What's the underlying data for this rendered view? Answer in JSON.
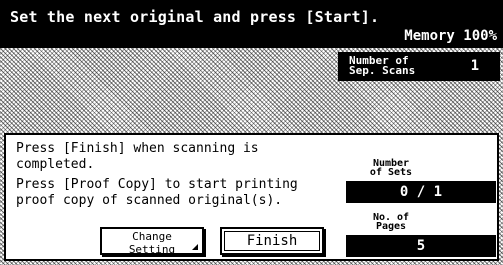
{
  "header": {
    "message": "Set the next original and press [Start].",
    "memory": "Memory 100%"
  },
  "sep_scans": {
    "label_line1": "Number of",
    "label_line2": "Sep. Scans",
    "value": "1"
  },
  "info": {
    "line1": "Press [Finish] when scanning is",
    "line2": "completed.",
    "line3": "Press [Proof Copy] to start printing",
    "line4": "proof copy of scanned original(s)."
  },
  "buttons": {
    "change_line1": "Change",
    "change_line2": "Setting",
    "finish": "Finish"
  },
  "counters": {
    "sets_label_line1": "Number",
    "sets_label_line2": "of Sets",
    "sets_value": "0 / 1",
    "pages_label_line1": "No. of",
    "pages_label_line2": "Pages",
    "pages_value": "5"
  }
}
